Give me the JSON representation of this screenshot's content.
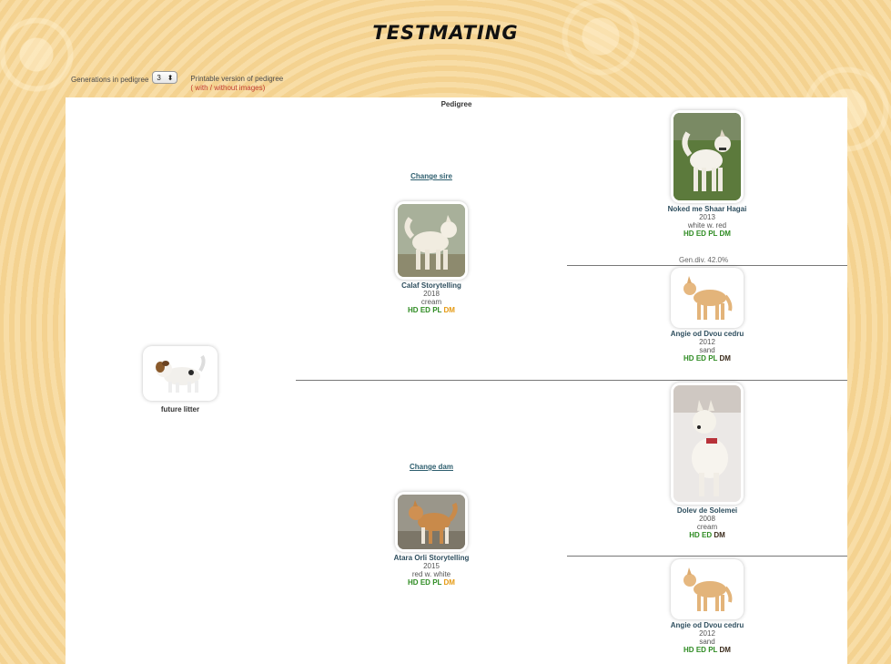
{
  "page": {
    "title": "TESTMATING"
  },
  "controls": {
    "generations_label": "Generations in pedigree",
    "generations_value": "3",
    "printable_label": "Printable version of pedigree",
    "printable_open": "(",
    "with_images": "with",
    "separator": "/",
    "without_images": "without images",
    "printable_close": ")"
  },
  "pedigree": {
    "title": "Pedigree",
    "change_sire": "Change sire",
    "change_dam": "Change dam",
    "gen_div": "Gen.div. 42.0%",
    "future_litter": {
      "name": "future litter"
    },
    "sire": {
      "name": "Calaf Storytelling",
      "year": "2018",
      "color": "cream",
      "tests": [
        "HD",
        "ED",
        "PL",
        "DM"
      ]
    },
    "dam": {
      "name": "Atara Orli Storytelling",
      "year": "2015",
      "color": "red w. white",
      "tests": [
        "HD",
        "ED",
        "PL",
        "DM"
      ]
    },
    "sire_sire": {
      "name": "Noked me Shaar Hagai",
      "year": "2013",
      "color": "white w. red",
      "tests": [
        "HD",
        "ED",
        "PL",
        "DM"
      ]
    },
    "sire_dam": {
      "name": "Angie od Dvou cedru",
      "year": "2012",
      "color": "sand",
      "tests": [
        "HD",
        "ED",
        "PL",
        "DM"
      ]
    },
    "dam_sire": {
      "name": "Dolev de Solemei",
      "year": "2008",
      "color": "cream",
      "tests": [
        "HD",
        "ED",
        "DM"
      ]
    },
    "dam_dam": {
      "name": "Angie od Dvou cedru",
      "year": "2012",
      "color": "sand",
      "tests": [
        "HD",
        "ED",
        "PL",
        "DM"
      ]
    }
  },
  "colors": {
    "test_pass": "#2e8b22",
    "test_carrier": "#e59a13",
    "test_clear_dark": "#3a2a1a",
    "link": "#c0392b"
  }
}
